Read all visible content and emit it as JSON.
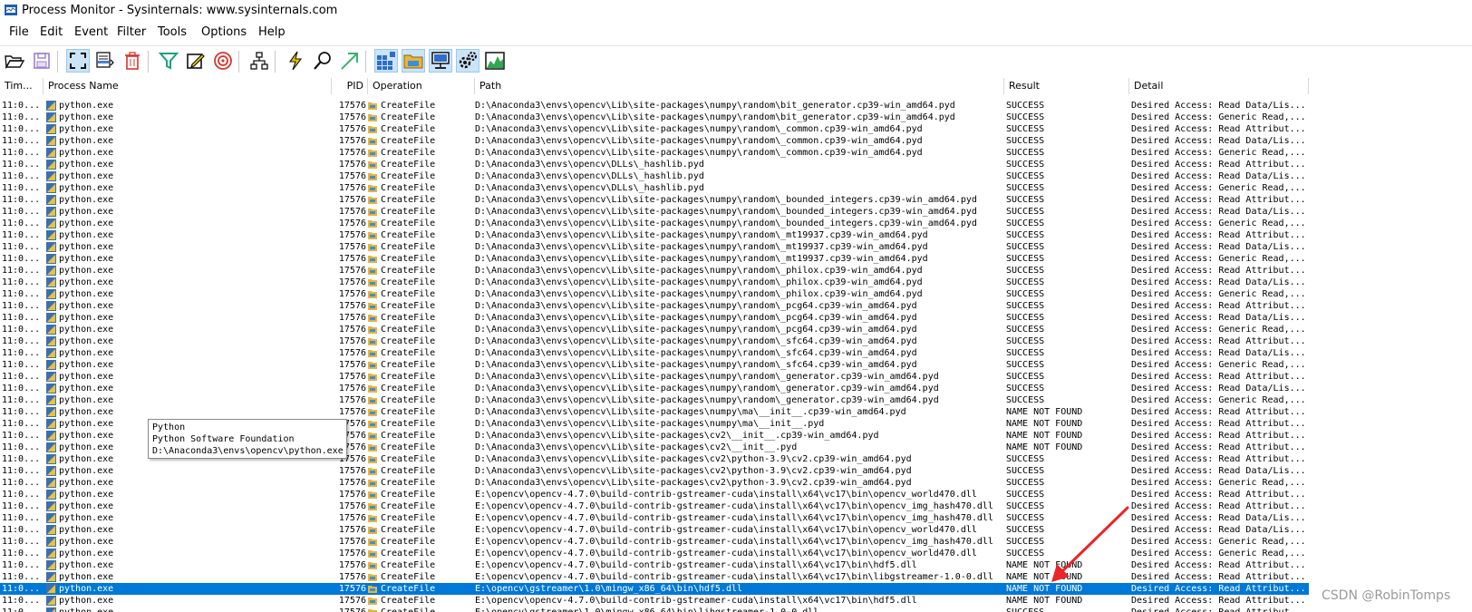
{
  "window": {
    "title": "Process Monitor - Sysinternals: www.sysinternals.com"
  },
  "menu": [
    "File",
    "Edit",
    "Event",
    "Filter",
    "Tools",
    "Options",
    "Help"
  ],
  "toolbar": [
    {
      "name": "open-icon"
    },
    {
      "name": "save-icon"
    },
    {
      "sep": true
    },
    {
      "name": "capture-icon",
      "pressed": true
    },
    {
      "name": "autoscroll-icon"
    },
    {
      "name": "clear-icon"
    },
    {
      "sep": true
    },
    {
      "name": "filter-icon"
    },
    {
      "name": "highlight-icon"
    },
    {
      "name": "include-process-icon"
    },
    {
      "sep": true
    },
    {
      "name": "process-tree-icon"
    },
    {
      "sep": true
    },
    {
      "name": "event-properties-icon"
    },
    {
      "name": "find-icon"
    },
    {
      "name": "jump-to-icon"
    },
    {
      "sep": true
    },
    {
      "name": "registry-activity-icon",
      "pressed": true
    },
    {
      "name": "filesystem-activity-icon",
      "pressed": true
    },
    {
      "name": "network-activity-icon",
      "pressed": true
    },
    {
      "name": "process-thread-activity-icon",
      "pressed": true
    },
    {
      "name": "profiling-events-icon"
    }
  ],
  "columns": {
    "time": "Tim...",
    "process": "Process Name",
    "pid": "PID",
    "operation": "Operation",
    "path": "Path",
    "result": "Result",
    "detail": "Detail"
  },
  "events": [
    {
      "time": "11:0...",
      "process": "python.exe",
      "pid": "17576",
      "op": "CreateFile",
      "path": "D:\\Anaconda3\\envs\\opencv\\Lib\\site-packages\\numpy\\random\\bit_generator.cp39-win_amd64.pyd",
      "result": "SUCCESS",
      "detail": "Desired Access: Read Data/Lis..."
    },
    {
      "time": "11:0...",
      "process": "python.exe",
      "pid": "17576",
      "op": "CreateFile",
      "path": "D:\\Anaconda3\\envs\\opencv\\Lib\\site-packages\\numpy\\random\\bit_generator.cp39-win_amd64.pyd",
      "result": "SUCCESS",
      "detail": "Desired Access: Generic Read,..."
    },
    {
      "time": "11:0...",
      "process": "python.exe",
      "pid": "17576",
      "op": "CreateFile",
      "path": "D:\\Anaconda3\\envs\\opencv\\Lib\\site-packages\\numpy\\random\\_common.cp39-win_amd64.pyd",
      "result": "SUCCESS",
      "detail": "Desired Access: Read Attribut..."
    },
    {
      "time": "11:0...",
      "process": "python.exe",
      "pid": "17576",
      "op": "CreateFile",
      "path": "D:\\Anaconda3\\envs\\opencv\\Lib\\site-packages\\numpy\\random\\_common.cp39-win_amd64.pyd",
      "result": "SUCCESS",
      "detail": "Desired Access: Read Data/Lis..."
    },
    {
      "time": "11:0...",
      "process": "python.exe",
      "pid": "17576",
      "op": "CreateFile",
      "path": "D:\\Anaconda3\\envs\\opencv\\Lib\\site-packages\\numpy\\random\\_common.cp39-win_amd64.pyd",
      "result": "SUCCESS",
      "detail": "Desired Access: Generic Read,..."
    },
    {
      "time": "11:0...",
      "process": "python.exe",
      "pid": "17576",
      "op": "CreateFile",
      "path": "D:\\Anaconda3\\envs\\opencv\\DLLs\\_hashlib.pyd",
      "result": "SUCCESS",
      "detail": "Desired Access: Read Attribut..."
    },
    {
      "time": "11:0...",
      "process": "python.exe",
      "pid": "17576",
      "op": "CreateFile",
      "path": "D:\\Anaconda3\\envs\\opencv\\DLLs\\_hashlib.pyd",
      "result": "SUCCESS",
      "detail": "Desired Access: Read Data/Lis..."
    },
    {
      "time": "11:0...",
      "process": "python.exe",
      "pid": "17576",
      "op": "CreateFile",
      "path": "D:\\Anaconda3\\envs\\opencv\\DLLs\\_hashlib.pyd",
      "result": "SUCCESS",
      "detail": "Desired Access: Generic Read,..."
    },
    {
      "time": "11:0...",
      "process": "python.exe",
      "pid": "17576",
      "op": "CreateFile",
      "path": "D:\\Anaconda3\\envs\\opencv\\Lib\\site-packages\\numpy\\random\\_bounded_integers.cp39-win_amd64.pyd",
      "result": "SUCCESS",
      "detail": "Desired Access: Read Attribut..."
    },
    {
      "time": "11:0...",
      "process": "python.exe",
      "pid": "17576",
      "op": "CreateFile",
      "path": "D:\\Anaconda3\\envs\\opencv\\Lib\\site-packages\\numpy\\random\\_bounded_integers.cp39-win_amd64.pyd",
      "result": "SUCCESS",
      "detail": "Desired Access: Read Data/Lis..."
    },
    {
      "time": "11:0...",
      "process": "python.exe",
      "pid": "17576",
      "op": "CreateFile",
      "path": "D:\\Anaconda3\\envs\\opencv\\Lib\\site-packages\\numpy\\random\\_bounded_integers.cp39-win_amd64.pyd",
      "result": "SUCCESS",
      "detail": "Desired Access: Generic Read,..."
    },
    {
      "time": "11:0...",
      "process": "python.exe",
      "pid": "17576",
      "op": "CreateFile",
      "path": "D:\\Anaconda3\\envs\\opencv\\Lib\\site-packages\\numpy\\random\\_mt19937.cp39-win_amd64.pyd",
      "result": "SUCCESS",
      "detail": "Desired Access: Read Attribut..."
    },
    {
      "time": "11:0...",
      "process": "python.exe",
      "pid": "17576",
      "op": "CreateFile",
      "path": "D:\\Anaconda3\\envs\\opencv\\Lib\\site-packages\\numpy\\random\\_mt19937.cp39-win_amd64.pyd",
      "result": "SUCCESS",
      "detail": "Desired Access: Read Data/Lis..."
    },
    {
      "time": "11:0...",
      "process": "python.exe",
      "pid": "17576",
      "op": "CreateFile",
      "path": "D:\\Anaconda3\\envs\\opencv\\Lib\\site-packages\\numpy\\random\\_mt19937.cp39-win_amd64.pyd",
      "result": "SUCCESS",
      "detail": "Desired Access: Generic Read,..."
    },
    {
      "time": "11:0...",
      "process": "python.exe",
      "pid": "17576",
      "op": "CreateFile",
      "path": "D:\\Anaconda3\\envs\\opencv\\Lib\\site-packages\\numpy\\random\\_philox.cp39-win_amd64.pyd",
      "result": "SUCCESS",
      "detail": "Desired Access: Read Attribut..."
    },
    {
      "time": "11:0...",
      "process": "python.exe",
      "pid": "17576",
      "op": "CreateFile",
      "path": "D:\\Anaconda3\\envs\\opencv\\Lib\\site-packages\\numpy\\random\\_philox.cp39-win_amd64.pyd",
      "result": "SUCCESS",
      "detail": "Desired Access: Read Data/Lis..."
    },
    {
      "time": "11:0...",
      "process": "python.exe",
      "pid": "17576",
      "op": "CreateFile",
      "path": "D:\\Anaconda3\\envs\\opencv\\Lib\\site-packages\\numpy\\random\\_philox.cp39-win_amd64.pyd",
      "result": "SUCCESS",
      "detail": "Desired Access: Generic Read,..."
    },
    {
      "time": "11:0...",
      "process": "python.exe",
      "pid": "17576",
      "op": "CreateFile",
      "path": "D:\\Anaconda3\\envs\\opencv\\Lib\\site-packages\\numpy\\random\\_pcg64.cp39-win_amd64.pyd",
      "result": "SUCCESS",
      "detail": "Desired Access: Read Attribut..."
    },
    {
      "time": "11:0...",
      "process": "python.exe",
      "pid": "17576",
      "op": "CreateFile",
      "path": "D:\\Anaconda3\\envs\\opencv\\Lib\\site-packages\\numpy\\random\\_pcg64.cp39-win_amd64.pyd",
      "result": "SUCCESS",
      "detail": "Desired Access: Read Data/Lis..."
    },
    {
      "time": "11:0...",
      "process": "python.exe",
      "pid": "17576",
      "op": "CreateFile",
      "path": "D:\\Anaconda3\\envs\\opencv\\Lib\\site-packages\\numpy\\random\\_pcg64.cp39-win_amd64.pyd",
      "result": "SUCCESS",
      "detail": "Desired Access: Generic Read,..."
    },
    {
      "time": "11:0...",
      "process": "python.exe",
      "pid": "17576",
      "op": "CreateFile",
      "path": "D:\\Anaconda3\\envs\\opencv\\Lib\\site-packages\\numpy\\random\\_sfc64.cp39-win_amd64.pyd",
      "result": "SUCCESS",
      "detail": "Desired Access: Read Attribut..."
    },
    {
      "time": "11:0...",
      "process": "python.exe",
      "pid": "17576",
      "op": "CreateFile",
      "path": "D:\\Anaconda3\\envs\\opencv\\Lib\\site-packages\\numpy\\random\\_sfc64.cp39-win_amd64.pyd",
      "result": "SUCCESS",
      "detail": "Desired Access: Read Data/Lis..."
    },
    {
      "time": "11:0...",
      "process": "python.exe",
      "pid": "17576",
      "op": "CreateFile",
      "path": "D:\\Anaconda3\\envs\\opencv\\Lib\\site-packages\\numpy\\random\\_sfc64.cp39-win_amd64.pyd",
      "result": "SUCCESS",
      "detail": "Desired Access: Generic Read,..."
    },
    {
      "time": "11:0...",
      "process": "python.exe",
      "pid": "17576",
      "op": "CreateFile",
      "path": "D:\\Anaconda3\\envs\\opencv\\Lib\\site-packages\\numpy\\random\\_generator.cp39-win_amd64.pyd",
      "result": "SUCCESS",
      "detail": "Desired Access: Read Attribut..."
    },
    {
      "time": "11:0...",
      "process": "python.exe",
      "pid": "17576",
      "op": "CreateFile",
      "path": "D:\\Anaconda3\\envs\\opencv\\Lib\\site-packages\\numpy\\random\\_generator.cp39-win_amd64.pyd",
      "result": "SUCCESS",
      "detail": "Desired Access: Read Data/Lis..."
    },
    {
      "time": "11:0...",
      "process": "python.exe",
      "pid": "17576",
      "op": "CreateFile",
      "path": "D:\\Anaconda3\\envs\\opencv\\Lib\\site-packages\\numpy\\random\\_generator.cp39-win_amd64.pyd",
      "result": "SUCCESS",
      "detail": "Desired Access: Generic Read,..."
    },
    {
      "time": "11:0...",
      "process": "python.exe",
      "pid": "17576",
      "op": "CreateFile",
      "path": "D:\\Anaconda3\\envs\\opencv\\Lib\\site-packages\\numpy\\ma\\__init__.cp39-win_amd64.pyd",
      "result": "NAME NOT FOUND",
      "detail": "Desired Access: Read Attribut..."
    },
    {
      "time": "11:0...",
      "process": "python.exe",
      "pid": "17576",
      "op": "CreateFile",
      "path": "D:\\Anaconda3\\envs\\opencv\\Lib\\site-packages\\numpy\\ma\\__init__.pyd",
      "result": "NAME NOT FOUND",
      "detail": "Desired Access: Read Attribut..."
    },
    {
      "time": "11:0...",
      "process": "python.exe",
      "pid": "17576",
      "op": "CreateFile",
      "path": "D:\\Anaconda3\\envs\\opencv\\Lib\\site-packages\\cv2\\__init__.cp39-win_amd64.pyd",
      "result": "NAME NOT FOUND",
      "detail": "Desired Access: Read Attribut..."
    },
    {
      "time": "11:0...",
      "process": "python.exe",
      "pid": "17576",
      "op": "CreateFile",
      "path": "D:\\Anaconda3\\envs\\opencv\\Lib\\site-packages\\cv2\\__init__.pyd",
      "result": "NAME NOT FOUND",
      "detail": "Desired Access: Read Attribut..."
    },
    {
      "time": "11:0...",
      "process": "python.exe",
      "pid": "17576",
      "op": "CreateFile",
      "path": "D:\\Anaconda3\\envs\\opencv\\Lib\\site-packages\\cv2\\python-3.9\\cv2.cp39-win_amd64.pyd",
      "result": "SUCCESS",
      "detail": "Desired Access: Read Attribut..."
    },
    {
      "time": "11:0...",
      "process": "python.exe",
      "pid": "17576",
      "op": "CreateFile",
      "path": "D:\\Anaconda3\\envs\\opencv\\Lib\\site-packages\\cv2\\python-3.9\\cv2.cp39-win_amd64.pyd",
      "result": "SUCCESS",
      "detail": "Desired Access: Read Data/Lis..."
    },
    {
      "time": "11:0...",
      "process": "python.exe",
      "pid": "17576",
      "op": "CreateFile",
      "path": "D:\\Anaconda3\\envs\\opencv\\Lib\\site-packages\\cv2\\python-3.9\\cv2.cp39-win_amd64.pyd",
      "result": "SUCCESS",
      "detail": "Desired Access: Generic Read,..."
    },
    {
      "time": "11:0...",
      "process": "python.exe",
      "pid": "17576",
      "op": "CreateFile",
      "path": "E:\\opencv\\opencv-4.7.0\\build-contrib-gstreamer-cuda\\install\\x64\\vc17\\bin\\opencv_world470.dll",
      "result": "SUCCESS",
      "detail": "Desired Access: Read Attribut..."
    },
    {
      "time": "11:0...",
      "process": "python.exe",
      "pid": "17576",
      "op": "CreateFile",
      "path": "E:\\opencv\\opencv-4.7.0\\build-contrib-gstreamer-cuda\\install\\x64\\vc17\\bin\\opencv_img_hash470.dll",
      "result": "SUCCESS",
      "detail": "Desired Access: Read Attribut..."
    },
    {
      "time": "11:0...",
      "process": "python.exe",
      "pid": "17576",
      "op": "CreateFile",
      "path": "E:\\opencv\\opencv-4.7.0\\build-contrib-gstreamer-cuda\\install\\x64\\vc17\\bin\\opencv_img_hash470.dll",
      "result": "SUCCESS",
      "detail": "Desired Access: Read Data/Lis..."
    },
    {
      "time": "11:0...",
      "process": "python.exe",
      "pid": "17576",
      "op": "CreateFile",
      "path": "E:\\opencv\\opencv-4.7.0\\build-contrib-gstreamer-cuda\\install\\x64\\vc17\\bin\\opencv_world470.dll",
      "result": "SUCCESS",
      "detail": "Desired Access: Read Data/Lis..."
    },
    {
      "time": "11:0...",
      "process": "python.exe",
      "pid": "17576",
      "op": "CreateFile",
      "path": "E:\\opencv\\opencv-4.7.0\\build-contrib-gstreamer-cuda\\install\\x64\\vc17\\bin\\opencv_img_hash470.dll",
      "result": "SUCCESS",
      "detail": "Desired Access: Generic Read,..."
    },
    {
      "time": "11:0...",
      "process": "python.exe",
      "pid": "17576",
      "op": "CreateFile",
      "path": "E:\\opencv\\opencv-4.7.0\\build-contrib-gstreamer-cuda\\install\\x64\\vc17\\bin\\opencv_world470.dll",
      "result": "SUCCESS",
      "detail": "Desired Access: Generic Read,..."
    },
    {
      "time": "11:0...",
      "process": "python.exe",
      "pid": "17576",
      "op": "CreateFile",
      "path": "E:\\opencv\\opencv-4.7.0\\build-contrib-gstreamer-cuda\\install\\x64\\vc17\\bin\\hdf5.dll",
      "result": "NAME NOT FOUND",
      "detail": "Desired Access: Read Attribut..."
    },
    {
      "time": "11:0...",
      "process": "python.exe",
      "pid": "17576",
      "op": "CreateFile",
      "path": "E:\\opencv\\opencv-4.7.0\\build-contrib-gstreamer-cuda\\install\\x64\\vc17\\bin\\libgstreamer-1.0-0.dll",
      "result": "NAME NOT FOUND",
      "detail": "Desired Access: Read Attribut..."
    },
    {
      "time": "11:0...",
      "process": "python.exe",
      "pid": "17576",
      "op": "CreateFile",
      "path": "E:\\opencv\\gstreamer\\1.0\\mingw_x86_64\\bin\\hdf5.dll",
      "result": "NAME NOT FOUND",
      "detail": "Desired Access: Read Attribut...",
      "selected": true
    },
    {
      "time": "11:0...",
      "process": "python.exe",
      "pid": "17576",
      "op": "CreateFile",
      "path": "E:\\opencv\\opencv-4.7.0\\build-contrib-gstreamer-cuda\\install\\x64\\vc17\\bin\\hdf5.dll",
      "result": "NAME NOT FOUND",
      "detail": "Desired Access: Read Attribut..."
    },
    {
      "time": "11:0...",
      "process": "python.exe",
      "pid": "17576",
      "op": "CreateFile",
      "path": "E:\\opencv\\gstreamer\\1.0\\mingw_x86_64\\bin\\libgstreamer-1.0-0.dll",
      "result": "SUCCESS",
      "detail": "Desired Access: Read Attribut..."
    }
  ],
  "tooltip": {
    "line1": "Python",
    "line2": "Python Software Foundation",
    "line3": "D:\\Anaconda3\\envs\\opencv\\python.exe"
  },
  "watermark": "CSDN @RobinTomps",
  "colors": {
    "selection": "#0078d7",
    "annotation_arrow": "#e8262a"
  }
}
